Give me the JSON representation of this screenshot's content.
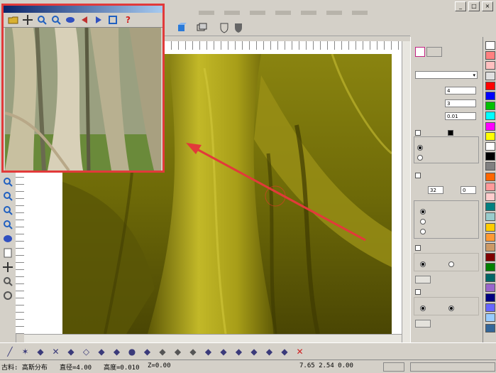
{
  "menubar": {
    "items": [
      "",
      "",
      "",
      "",
      "",
      "",
      "",
      "",
      "",
      "",
      "",
      ""
    ],
    "window_buttons": [
      "_",
      "□",
      "×"
    ]
  },
  "preview_window": {
    "title": "",
    "tools": [
      "open-icon",
      "move-icon",
      "zoom-in-icon",
      "zoom-out-icon",
      "eye-icon",
      "rotate-left-icon",
      "rotate-right-icon",
      "fit-icon",
      "help-icon"
    ],
    "help_glyph": "?"
  },
  "panel": {
    "title": "",
    "dropdown_value": "",
    "labels": {
      "diameter": "",
      "half_diameter": "",
      "height": "",
      "random": "",
      "shape": "",
      "stack": "",
      "pattern": "",
      "spacing": "",
      "depth": "",
      "color_mode": "",
      "color_none": "",
      "color_in": "",
      "color_out": "",
      "diameter_change": "",
      "height_change": ""
    },
    "values": {
      "diameter": "4",
      "half_diameter": "3",
      "height": "0.01",
      "spacing": "32",
      "depth": "0"
    }
  },
  "colors": {
    "accent_red": "#e23a3a",
    "palette": [
      "#ffffff",
      "#ff8080",
      "#ffc0c0",
      "#e0e0e0",
      "#ff0000",
      "#0000ff",
      "#00c000",
      "#00ffff",
      "#ff00ff",
      "#ffff00",
      "#ffffff",
      "#000000",
      "#808080",
      "#ff6600",
      "#ff9999",
      "#ffcccc",
      "#008080",
      "#99cccc",
      "#ffcc00",
      "#ff9933",
      "#cc9966",
      "#800000",
      "#008000",
      "#006666",
      "#9966cc",
      "#000080",
      "#6666ff",
      "#99ccff",
      "#336699"
    ]
  },
  "status": {
    "brush": "古料: 高斯分布",
    "diameter": "直径=4.00",
    "height": "高度=0.010",
    "z": "Z=0.00",
    "coords": "7.65  2.54  0.00"
  },
  "bottom_tools": [
    "pen-icon",
    "star-icon",
    "curve-icon",
    "cross-icon",
    "hook-icon",
    "diamond-icon",
    "perpendicular-icon",
    "bend-icon",
    "dot-icon",
    "spline-icon",
    "mesh-icon",
    "mesh2-icon",
    "mesh3-icon",
    "fill-icon",
    "fill2-icon",
    "pick-icon",
    "pick2-icon",
    "repeat-icon",
    "wand-icon",
    "delete-icon"
  ]
}
